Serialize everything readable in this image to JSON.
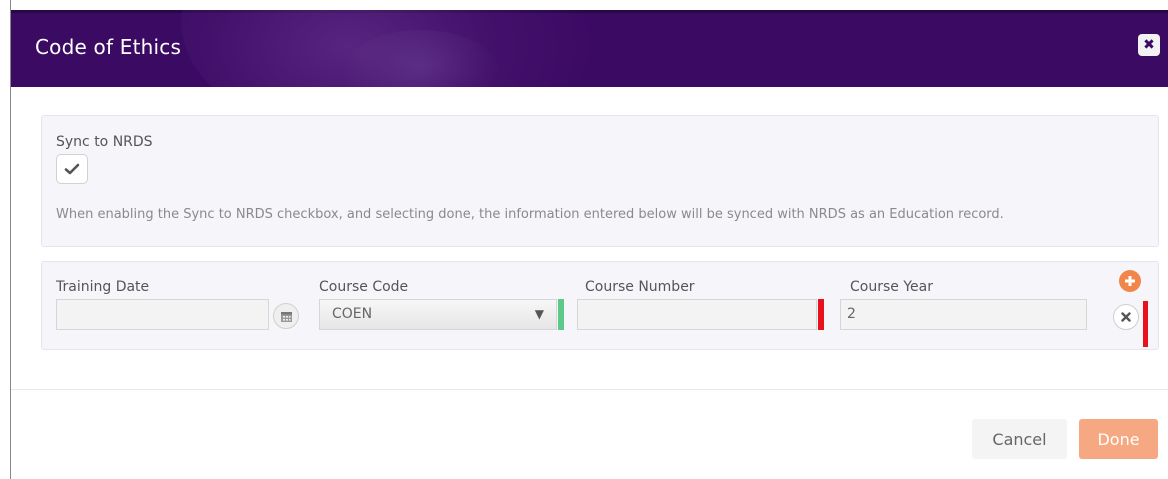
{
  "modal": {
    "title": "Code of Ethics"
  },
  "sync": {
    "label": "Sync to NRDS",
    "checked": true,
    "help_text": "When enabling the Sync to NRDS checkbox, and selecting done, the information entered below will be synced with NRDS as an Education record."
  },
  "row": {
    "training_date": {
      "label": "Training Date",
      "value": ""
    },
    "course_code": {
      "label": "Course Code",
      "value": "COEN"
    },
    "course_number": {
      "label": "Course Number",
      "value": ""
    },
    "course_year": {
      "label": "Course Year",
      "value": "2"
    }
  },
  "status_colors": {
    "valid": "#5cc98a",
    "required": "#e8121c"
  },
  "icons": {
    "close": "close-icon",
    "check": "check-icon",
    "calendar": "calendar-icon",
    "dropdown": "caret-down-icon",
    "add": "plus-icon",
    "remove": "x-icon"
  },
  "footer": {
    "cancel_label": "Cancel",
    "done_label": "Done"
  },
  "colors": {
    "header_bg": "#3b0a63",
    "done_button": "#f5a882",
    "add_button": "#f0864a"
  }
}
